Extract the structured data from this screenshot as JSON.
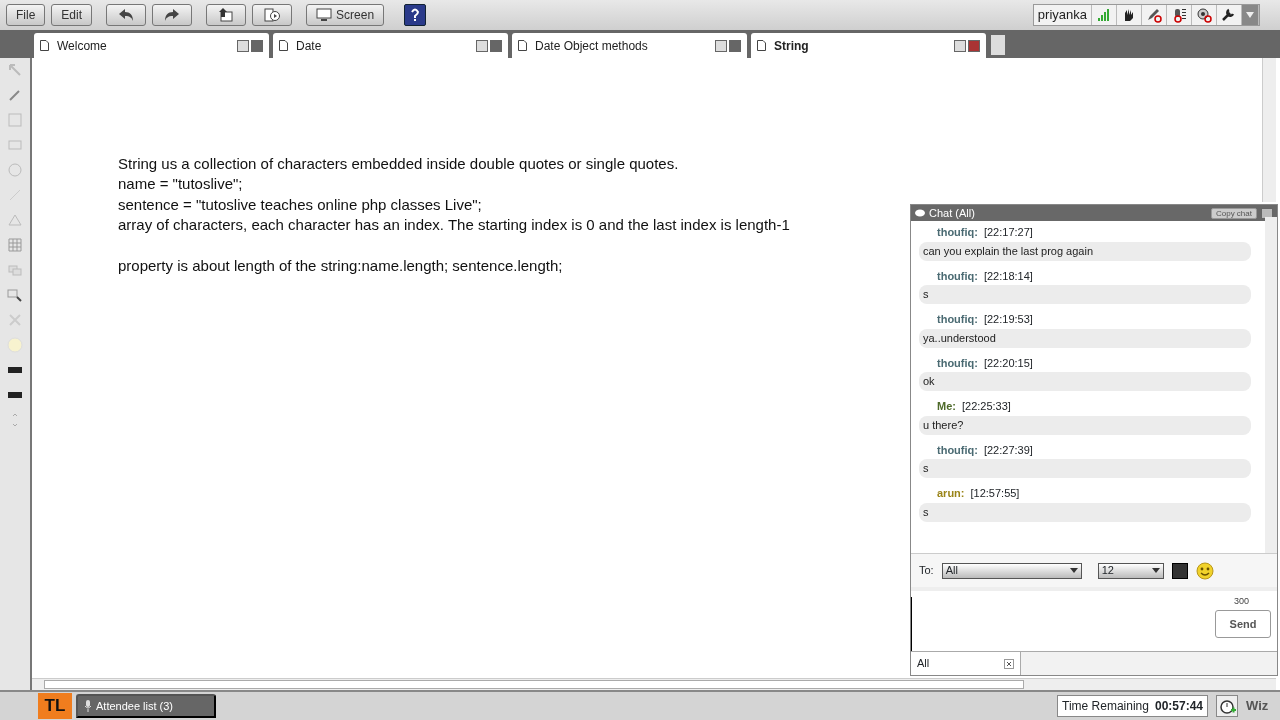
{
  "toolbar": {
    "buttons": [
      {
        "kind": "text",
        "label": "File"
      },
      {
        "kind": "text",
        "label": "Edit"
      },
      {
        "kind": "undo"
      },
      {
        "kind": "redo"
      },
      {
        "kind": "upload"
      },
      {
        "kind": "media"
      },
      {
        "kind": "screen",
        "label": "Screen"
      },
      {
        "kind": "help"
      }
    ],
    "user": {
      "name": "priyanka"
    }
  },
  "tabs": [
    {
      "label": "Welcome",
      "selected": false
    },
    {
      "label": "Date",
      "selected": false
    },
    {
      "label": "Date Object methods",
      "selected": false
    },
    {
      "label": "String",
      "selected": true
    }
  ],
  "whiteboard": {
    "blocks": [
      [
        "String us a collection of characters embedded inside double quotes or single quotes.",
        "name = \"tutoslive\";",
        "sentence = \"tutoslive teaches online php classes Live\";",
        "array of characters, each character has an index. The starting index is 0 and the last index is length-1"
      ],
      [
        "property is about length of the string:name.length; sentence.length;"
      ]
    ]
  },
  "chat": {
    "title": "Chat (All)",
    "copy_button": "Copy chat",
    "messages": [
      {
        "sender": "thoufiq:",
        "color": "#4a6a72",
        "time": "[22:17:27]",
        "text": "can you explain the last prog again"
      },
      {
        "sender": "thoufiq:",
        "color": "#4a6a72",
        "time": "[22:18:14]",
        "text": "s"
      },
      {
        "sender": "thoufiq:",
        "color": "#4a6a72",
        "time": "[22:19:53]",
        "text": "ya..understood"
      },
      {
        "sender": "thoufiq:",
        "color": "#4a6a72",
        "time": "[22:20:15]",
        "text": "ok"
      },
      {
        "sender": "Me:",
        "color": "#4e6a2a",
        "time": "[22:25:33]",
        "text": "u there?"
      },
      {
        "sender": "thoufiq:",
        "color": "#4a6a72",
        "time": "[22:27:39]",
        "text": "s"
      },
      {
        "sender": "arun:",
        "color": "#9a8418",
        "time": "[12:57:55]",
        "text": "s"
      }
    ],
    "to_label": "To:",
    "recipient": "All",
    "font_size": "12",
    "char_count": "300",
    "send": "Send",
    "bottom_tab": "All"
  },
  "status_bar": {
    "logo": "TL",
    "attendees": "Attendee list (3)",
    "time_label": "Time Remaining",
    "time": "00:57:44",
    "brand": "Wiz"
  }
}
